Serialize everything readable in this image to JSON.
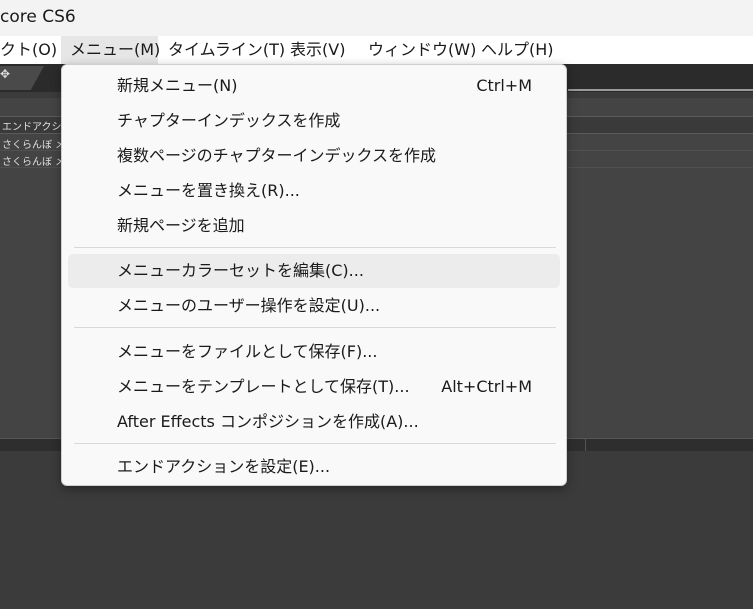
{
  "window": {
    "title": "core CS6"
  },
  "menubar": {
    "items": [
      {
        "label": "クト(O)"
      },
      {
        "label": "メニュー(M)"
      },
      {
        "label": "タイムライン(T)"
      },
      {
        "label": "表示(V)"
      },
      {
        "label": "ウィンドウ(W)"
      },
      {
        "label": "ヘルプ(H)"
      }
    ]
  },
  "panel": {
    "column_header": "エンドアクシ",
    "rows": [
      {
        "name": "さくらんぼ メイ"
      },
      {
        "name": "さくらんぼ メイ"
      }
    ]
  },
  "dropdown": {
    "items": [
      {
        "label": "新規メニュー(N)",
        "shortcut": "Ctrl+M"
      },
      {
        "label": "チャプターインデックスを作成",
        "shortcut": ""
      },
      {
        "label": "複数ページのチャプターインデックスを作成",
        "shortcut": ""
      },
      {
        "label": "メニューを置き換え(R)...",
        "shortcut": ""
      },
      {
        "label": "新規ページを追加",
        "shortcut": ""
      },
      {
        "label": "メニューカラーセットを編集(C)...",
        "shortcut": ""
      },
      {
        "label": "メニューのユーザー操作を設定(U)...",
        "shortcut": ""
      },
      {
        "label": "メニューをファイルとして保存(F)...",
        "shortcut": ""
      },
      {
        "label": "メニューをテンプレートとして保存(T)...",
        "shortcut": "Alt+Ctrl+M"
      },
      {
        "label": "After Effects コンポジションを作成(A)...",
        "shortcut": ""
      },
      {
        "label": "エンドアクションを設定(E)...",
        "shortcut": ""
      }
    ]
  },
  "colors": {
    "menu_background": "#f9f9f9",
    "menu_hover": "#ececec",
    "app_background": "#3b3b3b",
    "titlebar": "#f3f3f3"
  }
}
